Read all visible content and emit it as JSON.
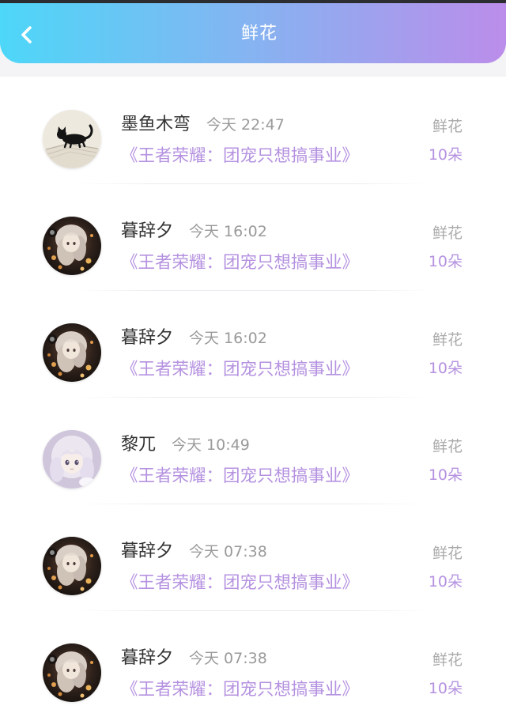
{
  "header": {
    "title": "鲜花",
    "back_icon": "chevron-left-icon"
  },
  "colors": {
    "header_gradient_start": "#4dd7f8",
    "header_gradient_end": "#bb8dea",
    "accent": "#b592e0",
    "name": "#333333",
    "time": "#9a9a9a",
    "label": "#aaaaaa"
  },
  "records": [
    {
      "avatar": "black-cat-avatar",
      "name": "墨鱼木弯",
      "time": "今天 22:47",
      "book": "《王者荣耀：团宠只想搞事业》",
      "label": "鲜花",
      "amount": "10朵"
    },
    {
      "avatar": "anime-girl-dark-avatar",
      "name": "暮辞夕",
      "time": "今天 16:02",
      "book": "《王者荣耀：团宠只想搞事业》",
      "label": "鲜花",
      "amount": "10朵"
    },
    {
      "avatar": "anime-girl-dark-avatar",
      "name": "暮辞夕",
      "time": "今天 16:02",
      "book": "《王者荣耀：团宠只想搞事业》",
      "label": "鲜花",
      "amount": "10朵"
    },
    {
      "avatar": "anime-girl-light-avatar",
      "name": "黎兀",
      "time": "今天 10:49",
      "book": "《王者荣耀：团宠只想搞事业》",
      "label": "鲜花",
      "amount": "10朵"
    },
    {
      "avatar": "anime-girl-dark-avatar",
      "name": "暮辞夕",
      "time": "今天 07:38",
      "book": "《王者荣耀：团宠只想搞事业》",
      "label": "鲜花",
      "amount": "10朵"
    },
    {
      "avatar": "anime-girl-dark-avatar",
      "name": "暮辞夕",
      "time": "今天 07:38",
      "book": "《王者荣耀：团宠只想搞事业》",
      "label": "鲜花",
      "amount": "10朵"
    }
  ]
}
